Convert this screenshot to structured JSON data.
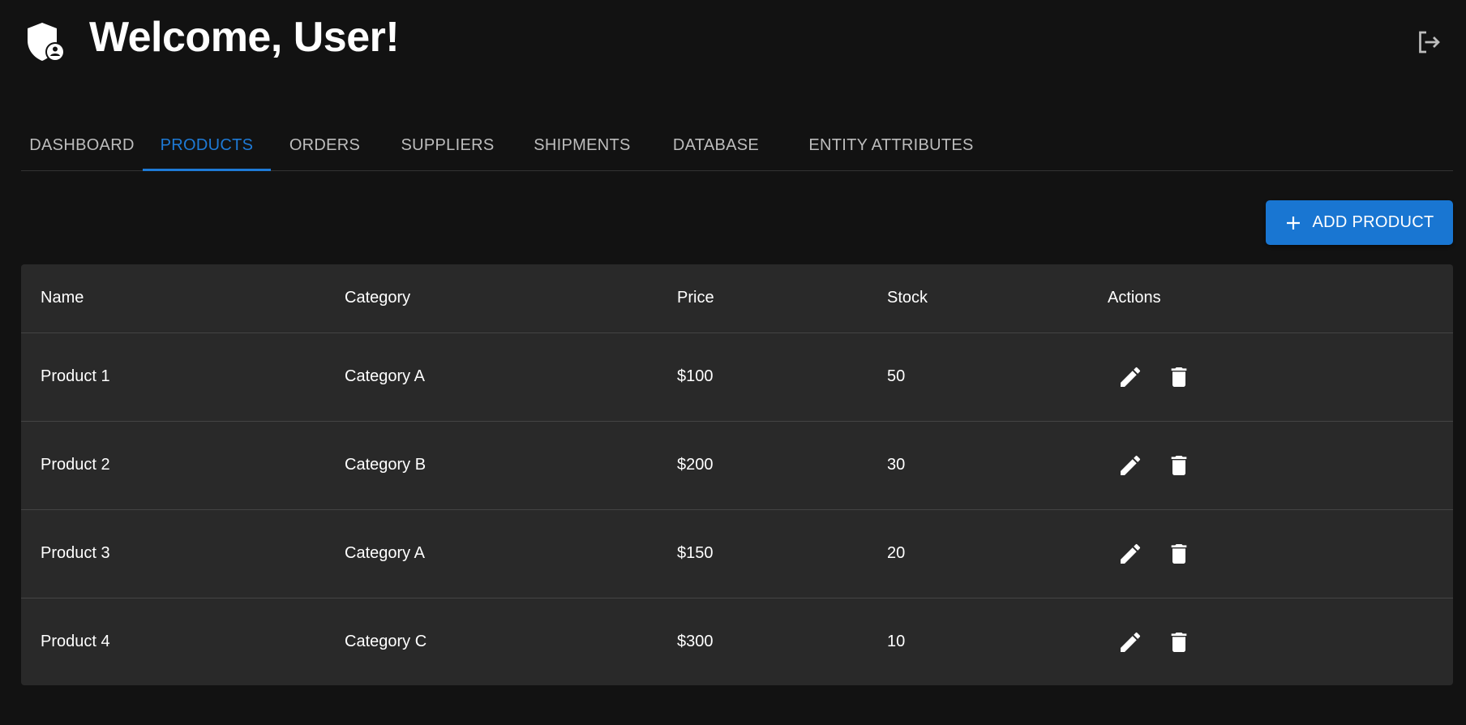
{
  "header": {
    "title": "Welcome, User!",
    "logo_icon": "shield-user-icon",
    "logout_icon": "logout-icon"
  },
  "tabs": [
    {
      "label": "DASHBOARD",
      "active": false
    },
    {
      "label": "PRODUCTS",
      "active": true
    },
    {
      "label": "ORDERS",
      "active": false
    },
    {
      "label": "SUPPLIERS",
      "active": false
    },
    {
      "label": "SHIPMENTS",
      "active": false
    },
    {
      "label": "DATABASE",
      "active": false
    },
    {
      "label": "ENTITY ATTRIBUTES",
      "active": false
    }
  ],
  "toolbar": {
    "add_label": "ADD PRODUCT",
    "add_icon": "plus-icon"
  },
  "table": {
    "headers": [
      "Name",
      "Category",
      "Price",
      "Stock",
      "Actions"
    ],
    "rows": [
      {
        "name": "Product 1",
        "category": "Category A",
        "price": "$100",
        "stock": "50"
      },
      {
        "name": "Product 2",
        "category": "Category B",
        "price": "$200",
        "stock": "30"
      },
      {
        "name": "Product 3",
        "category": "Category A",
        "price": "$150",
        "stock": "20"
      },
      {
        "name": "Product 4",
        "category": "Category C",
        "price": "$300",
        "stock": "10"
      }
    ],
    "row_action_icons": [
      "edit-icon",
      "delete-icon"
    ]
  },
  "colors": {
    "background": "#121212",
    "surface": "#292929",
    "accent": "#1976d2",
    "active_tab": "#1e7ad6",
    "tab_text": "#bdbdbd"
  }
}
